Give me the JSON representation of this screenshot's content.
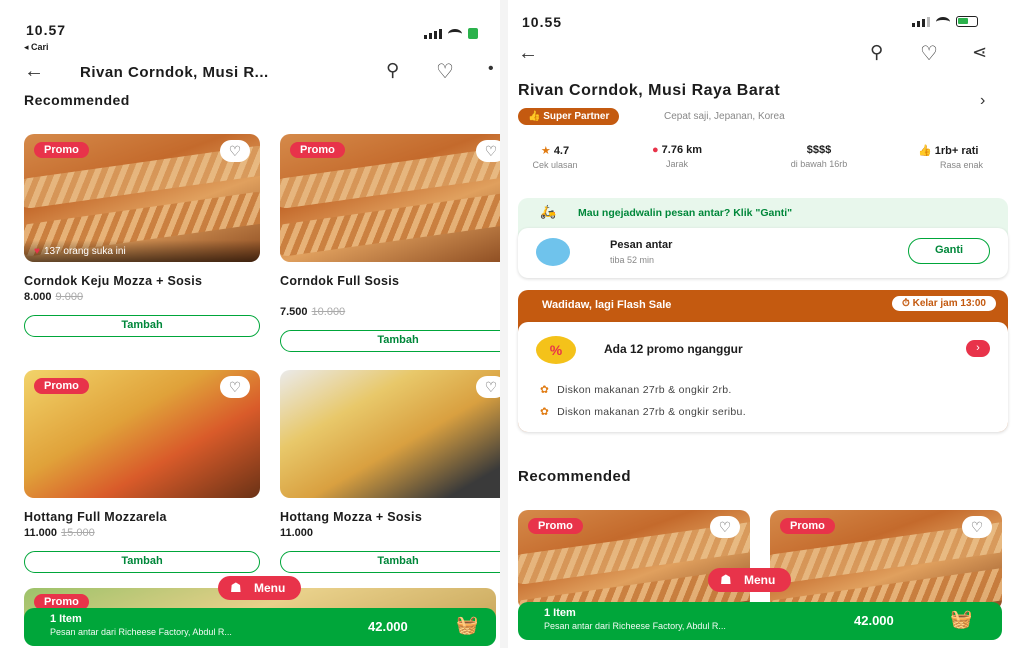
{
  "left": {
    "status_time": "10.57",
    "back_app": "◂ Cari",
    "title": "Rivan Corndok, Musi R...",
    "recommended_label": "Recommended",
    "cards": [
      {
        "promo": "Promo",
        "likes": "137 orang suka ini",
        "name": "Corndok Keju Mozza + Sosis",
        "price": "8.000",
        "old_price": "9.000",
        "button": "Tambah"
      },
      {
        "promo": "Promo",
        "name": "Corndok Full Sosis",
        "price": "7.500",
        "old_price": "10.000",
        "button": "Tambah"
      },
      {
        "promo": "Promo",
        "name": "Hottang Full Mozzarela",
        "price": "11.000",
        "old_price": "15.000",
        "button": "Tambah"
      },
      {
        "promo": "",
        "name": "Hottang Mozza + Sosis",
        "price": "11.000",
        "old_price": "",
        "button": "Tambah"
      }
    ],
    "bottom_promo": "Promo",
    "menu_label": "Menu",
    "cart": {
      "count": "1 Item",
      "desc": "Pesan antar dari Richeese Factory, Abdul R...",
      "amount": "42.000"
    }
  },
  "right": {
    "status_time": "10.55",
    "restaurant_name": "Rivan Corndok, Musi Raya Barat",
    "badge": "Super Partner",
    "categories": "Cepat saji, Jepanan, Korea",
    "stats": [
      {
        "value": "4.7",
        "label": "Cek ulasan"
      },
      {
        "value": "7.76 km",
        "label": "Jarak"
      },
      {
        "value": "$$$$",
        "label": "di bawah 16rb"
      },
      {
        "value": "1rb+ rati",
        "label": "Rasa enak"
      }
    ],
    "schedule_text": "Mau ngejadwalin pesan antar? Klik \"Ganti\"",
    "delivery_title": "Pesan antar",
    "delivery_eta": "tiba 52 min",
    "ganti_button": "Ganti",
    "flash_title": "Wadidaw, lagi Flash Sale",
    "flash_timer": "Kelar jam 13:00",
    "promo_count": "Ada 12 promo nganggur",
    "promo_rows": [
      "Diskon makanan 27rb & ongkir 2rb.",
      "Diskon makanan 27rb & ongkir seribu."
    ],
    "recommended_label": "Recommended",
    "promos": [
      "Promo",
      "Promo"
    ],
    "menu_label": "Menu",
    "cart": {
      "count": "1 Item",
      "desc": "Pesan antar dari Richeese Factory, Abdul R...",
      "amount": "42.000"
    }
  },
  "colors": {
    "green": "#00a63a",
    "red": "#e8334a",
    "orange": "#c45a10"
  }
}
